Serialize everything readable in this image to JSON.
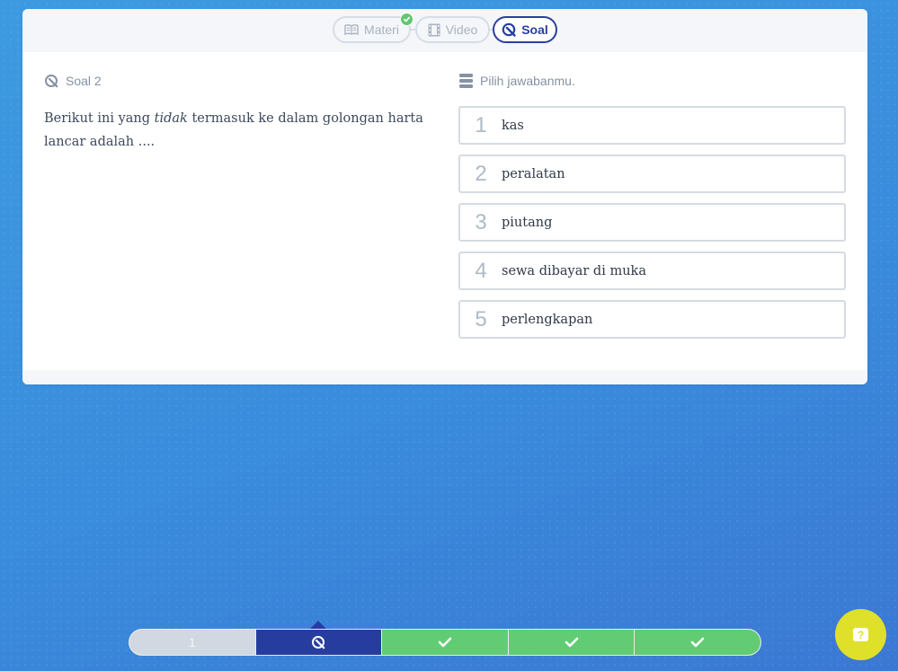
{
  "tabs": [
    {
      "label": "Materi",
      "icon": "book-icon",
      "completed": true
    },
    {
      "label": "Video",
      "icon": "film-icon"
    },
    {
      "label": "Soal",
      "icon": "quiz-icon",
      "active": true
    }
  ],
  "question": {
    "label": "Soal 2",
    "text_before": "Berikut ini yang ",
    "text_emphasis": "tidak",
    "text_after": " termasuk ke dalam golongan harta lancar adalah ...."
  },
  "answers": {
    "label": "Pilih jawabanmu.",
    "options": [
      {
        "number": "1",
        "text": "kas"
      },
      {
        "number": "2",
        "text": "peralatan"
      },
      {
        "number": "3",
        "text": "piutang"
      },
      {
        "number": "4",
        "text": "sewa dibayar di muka"
      },
      {
        "number": "5",
        "text": "perlengkapan"
      }
    ]
  },
  "progress": {
    "segments": [
      {
        "label": "1",
        "state": "pending"
      },
      {
        "label": "",
        "state": "current",
        "icon": "quiz-icon"
      },
      {
        "label": "",
        "state": "done",
        "icon": "check-icon"
      },
      {
        "label": "",
        "state": "done",
        "icon": "check-icon"
      },
      {
        "label": "",
        "state": "done",
        "icon": "check-icon"
      }
    ]
  },
  "help_button": {
    "icon": "help-icon",
    "glyph": "?"
  },
  "colors": {
    "accent": "#2a3f9e",
    "success": "#62cc74",
    "help": "#dfe029",
    "background": "#3a8cdc"
  }
}
